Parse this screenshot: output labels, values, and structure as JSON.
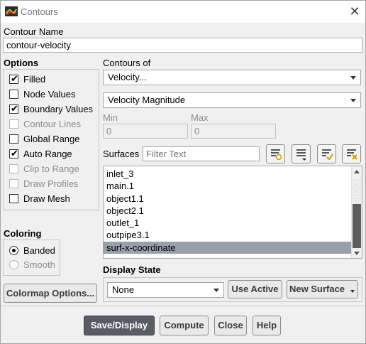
{
  "window": {
    "title": "Contours"
  },
  "contour_name": {
    "label": "Contour Name",
    "value": "contour-velocity"
  },
  "options": {
    "heading": "Options",
    "items": [
      {
        "label": "Filled",
        "checked": true,
        "enabled": true
      },
      {
        "label": "Node Values",
        "checked": false,
        "enabled": true
      },
      {
        "label": "Boundary Values",
        "checked": true,
        "enabled": true
      },
      {
        "label": "Contour Lines",
        "checked": false,
        "enabled": false
      },
      {
        "label": "Global Range",
        "checked": false,
        "enabled": true
      },
      {
        "label": "Auto Range",
        "checked": true,
        "enabled": true
      },
      {
        "label": "Clip to Range",
        "checked": false,
        "enabled": false
      },
      {
        "label": "Draw Profiles",
        "checked": false,
        "enabled": false
      },
      {
        "label": "Draw Mesh",
        "checked": false,
        "enabled": true
      }
    ]
  },
  "coloring": {
    "heading": "Coloring",
    "banded": "Banded",
    "smooth": "Smooth",
    "selected": "Banded"
  },
  "colormap_button": "Colormap Options...",
  "contours_of": {
    "label": "Contours of",
    "quantity": "Velocity...",
    "component": "Velocity Magnitude",
    "min_label": "Min",
    "min_value": "0",
    "max_label": "Max",
    "max_value": "0"
  },
  "surfaces": {
    "label": "Surfaces",
    "filter_placeholder": "Filter Text",
    "items": [
      "inlet_3",
      "main.1",
      "object1.1",
      "object2.1",
      "outlet_1",
      "outpipe3.1",
      "surf-x-coordinate"
    ],
    "selected": "surf-x-coordinate"
  },
  "display_state": {
    "label": "Display State",
    "value": "None",
    "use_active": "Use Active",
    "new_surface": "New Surface"
  },
  "footer": {
    "save_display": "Save/Display",
    "compute": "Compute",
    "close": "Close",
    "help": "Help"
  },
  "icons": {
    "app": "fluent-logo-icon",
    "close": "close-icon",
    "surface_tools": [
      "select-new-surface-icon",
      "deselect-list-icon",
      "select-all-icon",
      "clear-selection-icon"
    ]
  }
}
